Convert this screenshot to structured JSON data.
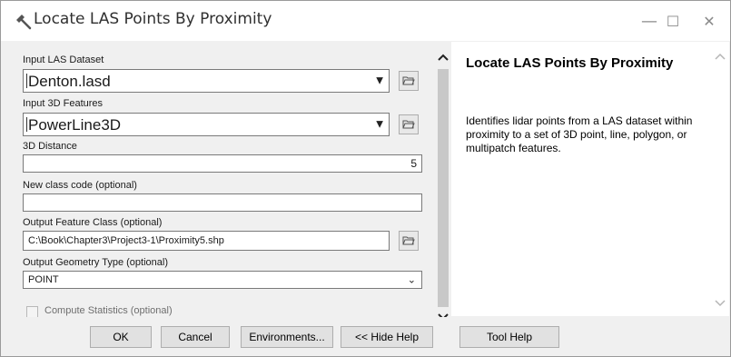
{
  "window": {
    "title": "Locate LAS Points By Proximity",
    "minimize_glyph": "—",
    "maximize_glyph": "☐",
    "close_glyph": "✕"
  },
  "form": {
    "input_las_label": "Input LAS Dataset",
    "input_las_value": "Denton.lasd",
    "input_3d_label": "Input 3D Features",
    "input_3d_value": "PowerLine3D",
    "distance_label": "3D Distance",
    "distance_value": "5",
    "class_code_label": "New class code (optional)",
    "class_code_value": "",
    "output_fc_label": "Output Feature Class (optional)",
    "output_fc_value": "C:\\Book\\Chapter3\\Project3-1\\Proximity5.shp",
    "geom_type_label": "Output Geometry Type (optional)",
    "geom_type_value": "POINT",
    "compute_stats_label": "Compute Statistics (optional)",
    "compute_stats_checked": false
  },
  "help": {
    "title": "Locate LAS Points By Proximity",
    "description": "Identifies lidar points from a LAS dataset within proximity to a set of 3D point, line, polygon, or multipatch features."
  },
  "buttons": {
    "ok": "OK",
    "cancel": "Cancel",
    "environments": "Environments...",
    "hide_help": "<< Hide Help",
    "tool_help": "Tool Help"
  },
  "icons": {
    "title": "hammer-icon",
    "browse": "folder-open-icon"
  }
}
